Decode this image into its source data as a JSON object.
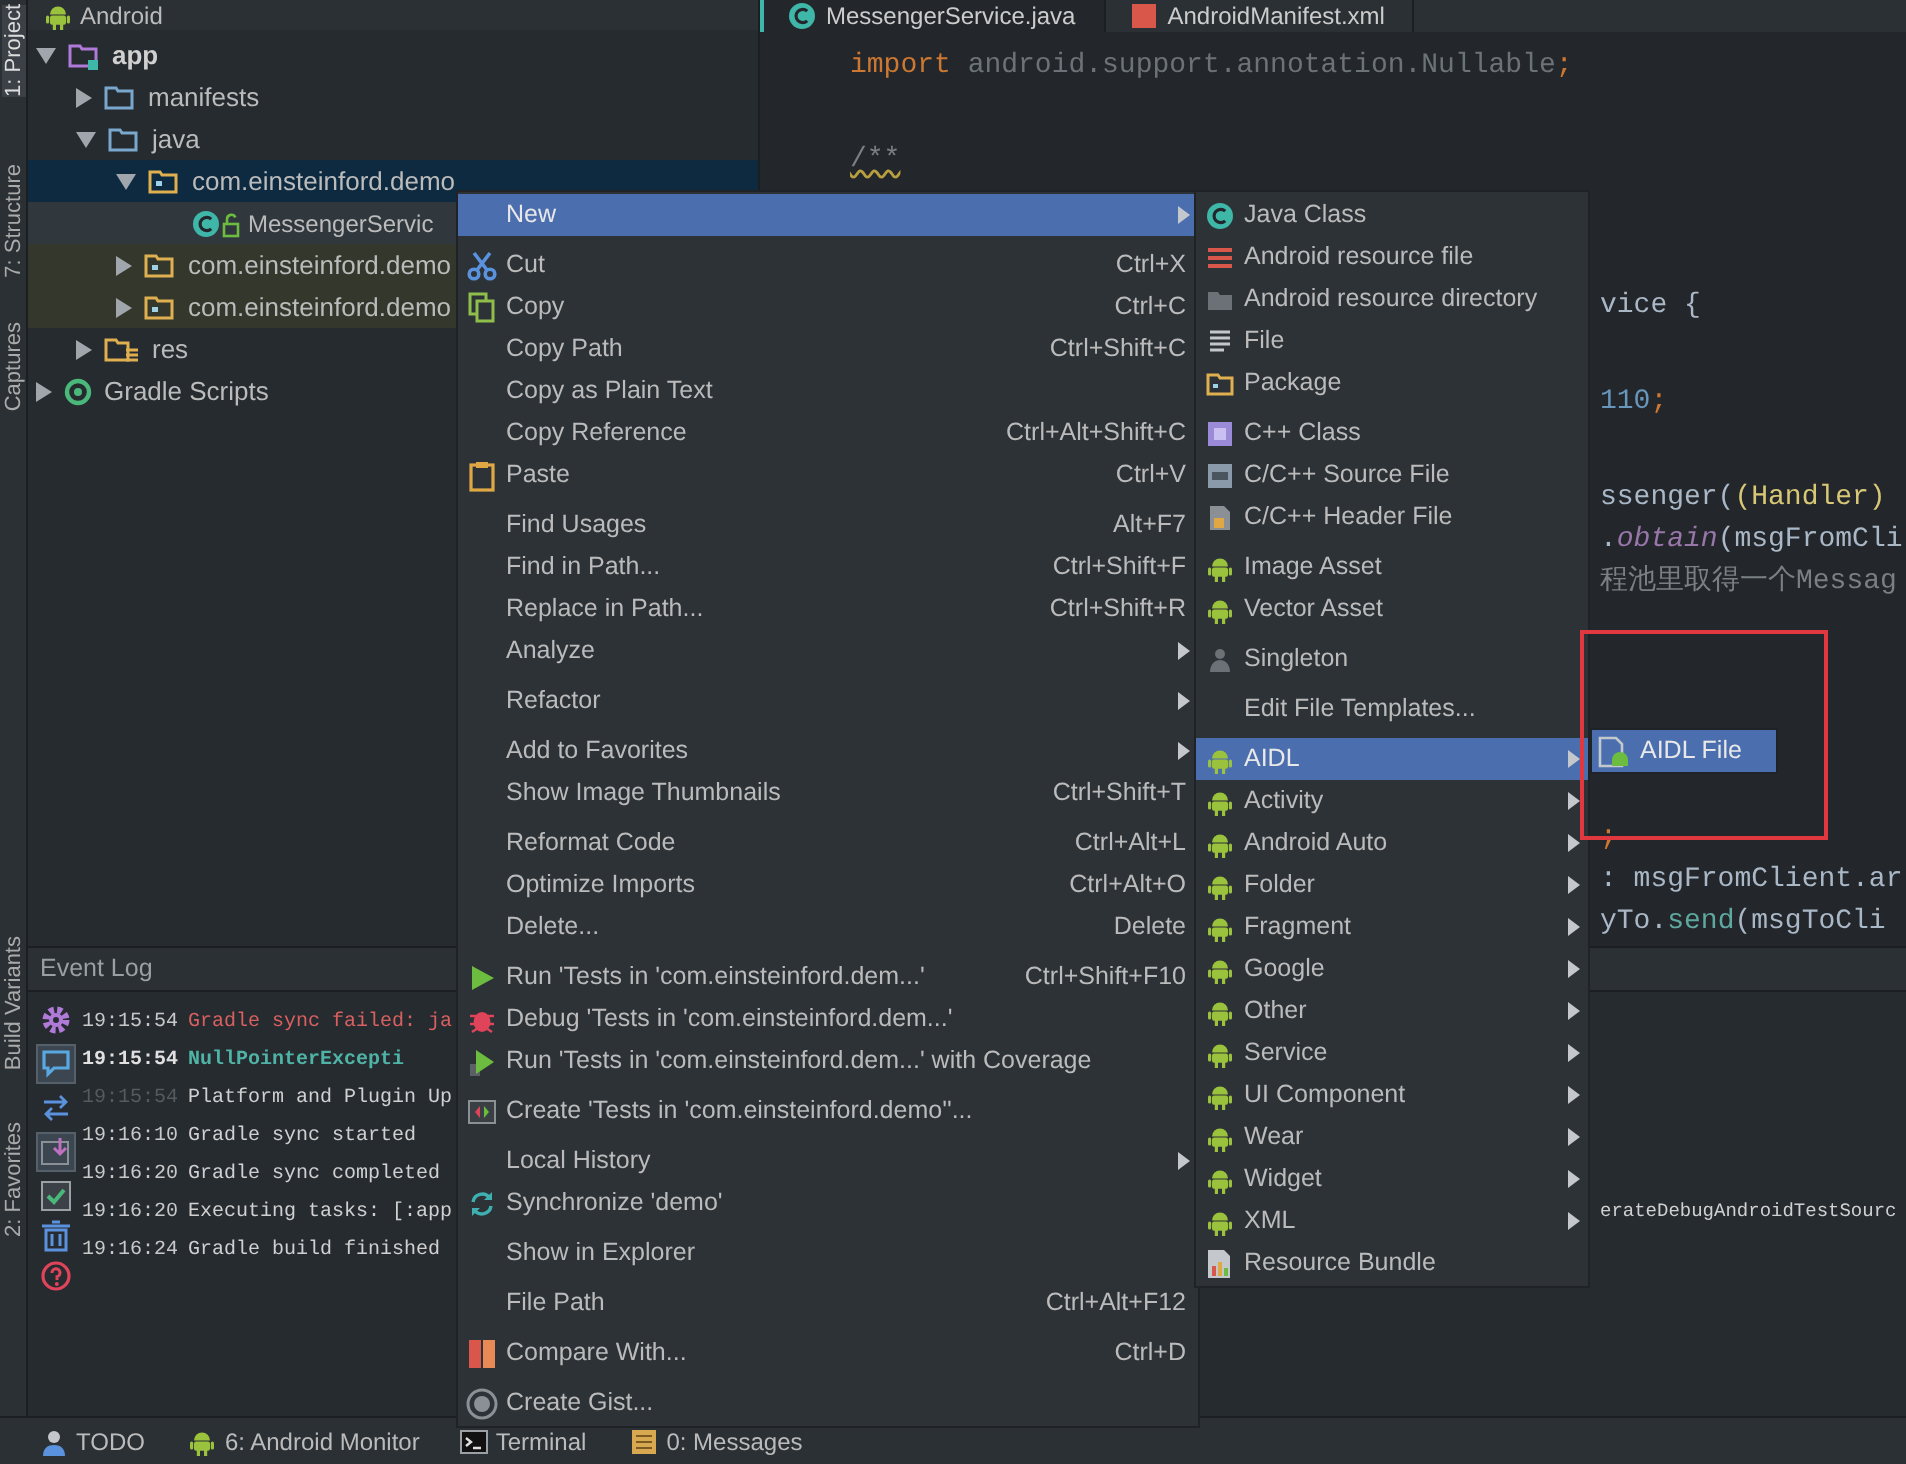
{
  "tool_strip": [
    {
      "label": "1: Project",
      "selected": true
    },
    {
      "label": "7: Structure",
      "selected": false
    },
    {
      "label": "Captures",
      "selected": false
    },
    {
      "label": "Build Variants",
      "selected": false
    },
    {
      "label": "2: Favorites",
      "selected": false
    }
  ],
  "project_panel": {
    "view": "Android",
    "tree": [
      {
        "label": "app",
        "kind": "module",
        "expanded": true,
        "selected": false,
        "children": [
          {
            "label": "manifests",
            "kind": "folder",
            "expanded": false,
            "selected": false
          },
          {
            "label": "java",
            "kind": "folder",
            "expanded": true,
            "selected": false,
            "children": [
              {
                "label": "com.einsteinford.demo",
                "kind": "package",
                "expanded": true,
                "selected": true,
                "children": [
                  {
                    "label": "MessengerServic",
                    "kind": "class",
                    "selected": false,
                    "color": "#30383d"
                  }
                ]
              },
              {
                "label": "com.einsteinford.demo",
                "kind": "package",
                "expanded": false,
                "selected": false,
                "color": "#33372c"
              },
              {
                "label": "com.einsteinford.demo",
                "kind": "package",
                "expanded": false,
                "selected": false,
                "color": "#33372c"
              }
            ]
          },
          {
            "label": "res",
            "kind": "res",
            "expanded": false,
            "selected": false
          }
        ]
      },
      {
        "label": "Gradle Scripts",
        "kind": "gradle",
        "expanded": false,
        "selected": false
      }
    ]
  },
  "editor": {
    "tabs": [
      {
        "label": "MessengerService.java",
        "kind": "class",
        "selected": true
      },
      {
        "label": "AndroidManifest.xml",
        "kind": "xml",
        "selected": false
      }
    ],
    "lines": [
      {
        "kind": "full",
        "segments": [
          {
            "text": "import",
            "kind": "keyword"
          },
          {
            "text": " android.support.annotation.Nullable",
            "kind": "unused"
          },
          {
            "text": ";",
            "kind": "keyword"
          }
        ]
      },
      {
        "kind": "doc",
        "segments": [
          {
            "text": "/**",
            "kind": "comment"
          }
        ]
      },
      {
        "kind": "fragment",
        "segments": [
          {
            "text": "vice {",
            "kind": "plain"
          }
        ]
      },
      {
        "kind": "fragment",
        "segments": [
          {
            "text": "110",
            "kind": "number"
          },
          {
            "text": ";",
            "kind": "keyword"
          }
        ]
      },
      {
        "kind": "fragment",
        "segments": [
          {
            "text": "ssenger(",
            "kind": "plain"
          },
          {
            "text": "(Handler)",
            "kind": "type"
          }
        ]
      },
      {
        "kind": "fragment",
        "segments": [
          {
            "text": ".",
            "kind": "plain"
          },
          {
            "text": "obtain",
            "kind": "static"
          },
          {
            "text": "(msgFromCli",
            "kind": "plain"
          }
        ]
      },
      {
        "kind": "fragment",
        "segments": [
          {
            "text": "程池里取得一个Messag",
            "kind": "comment"
          }
        ]
      },
      {
        "kind": "fragment",
        "segments": [
          {
            "text": ";",
            "kind": "keyword"
          }
        ]
      },
      {
        "kind": "fragment",
        "segments": [
          {
            "text": ": msgFromClient.ar",
            "kind": "plain"
          }
        ]
      },
      {
        "kind": "fragment",
        "segments": [
          {
            "text": "yTo.",
            "kind": "plain"
          },
          {
            "text": "send",
            "kind": "method"
          },
          {
            "text": "(msgToCli",
            "kind": "plain"
          }
        ]
      }
    ]
  },
  "event_log": {
    "title": "Event Log",
    "entries": [
      {
        "time": "19:15:54",
        "message": "Gradle sync failed: ja",
        "kind": "error"
      },
      {
        "time": "19:15:54",
        "message": "NullPointerExcepti",
        "kind": "bold"
      },
      {
        "time": "19:15:54",
        "message": "Platform and Plugin Up",
        "kind": "read"
      },
      {
        "time": "19:16:10",
        "message": "Gradle sync started",
        "kind": "normal"
      },
      {
        "time": "19:16:20",
        "message": "Gradle sync completed",
        "kind": "normal"
      },
      {
        "time": "19:16:20",
        "message": "Executing tasks: [:app",
        "kind": "normal",
        "tail": "erateDebugAndroidTestSourc"
      },
      {
        "time": "19:16:24",
        "message": "Gradle build finished",
        "kind": "normal"
      }
    ]
  },
  "context_menu": {
    "groups": [
      [
        {
          "label": "New",
          "submenu": true,
          "selected": true
        }
      ],
      [
        {
          "label": "Cut",
          "shortcut": "Ctrl+X",
          "kind": "scissors",
          "selected": false
        },
        {
          "label": "Copy",
          "shortcut": "Ctrl+C",
          "kind": "copy",
          "selected": false
        },
        {
          "label": "Copy Path",
          "shortcut": "Ctrl+Shift+C",
          "selected": false
        },
        {
          "label": "Copy as Plain Text",
          "selected": false
        },
        {
          "label": "Copy Reference",
          "shortcut": "Ctrl+Alt+Shift+C",
          "selected": false
        },
        {
          "label": "Paste",
          "shortcut": "Ctrl+V",
          "kind": "paste",
          "selected": false
        }
      ],
      [
        {
          "label": "Find Usages",
          "shortcut": "Alt+F7",
          "selected": false
        },
        {
          "label": "Find in Path...",
          "shortcut": "Ctrl+Shift+F",
          "selected": false
        },
        {
          "label": "Replace in Path...",
          "shortcut": "Ctrl+Shift+R",
          "selected": false
        },
        {
          "label": "Analyze",
          "submenu": true,
          "selected": false
        }
      ],
      [
        {
          "label": "Refactor",
          "submenu": true,
          "selected": false
        }
      ],
      [
        {
          "label": "Add to Favorites",
          "submenu": true,
          "selected": false
        },
        {
          "label": "Show Image Thumbnails",
          "shortcut": "Ctrl+Shift+T",
          "selected": false
        }
      ],
      [
        {
          "label": "Reformat Code",
          "shortcut": "Ctrl+Alt+L",
          "selected": false
        },
        {
          "label": "Optimize Imports",
          "shortcut": "Ctrl+Alt+O",
          "selected": false
        },
        {
          "label": "Delete...",
          "shortcut": "Delete",
          "selected": false
        }
      ],
      [
        {
          "label": "Run 'Tests in 'com.einsteinford.dem...'",
          "shortcut": "Ctrl+Shift+F10",
          "kind": "run",
          "selected": false
        },
        {
          "label": "Debug 'Tests in 'com.einsteinford.dem...'",
          "kind": "debug",
          "selected": false
        },
        {
          "label": "Run 'Tests in 'com.einsteinford.dem...' with Coverage",
          "kind": "coverage",
          "selected": false
        }
      ],
      [
        {
          "label": "Create 'Tests in 'com.einsteinford.demo''...",
          "kind": "tests",
          "selected": false
        }
      ],
      [
        {
          "label": "Local History",
          "submenu": true,
          "selected": false
        },
        {
          "label": "Synchronize 'demo'",
          "kind": "sync",
          "selected": false
        }
      ],
      [
        {
          "label": "Show in Explorer",
          "selected": false
        }
      ],
      [
        {
          "label": "File Path",
          "shortcut": "Ctrl+Alt+F12",
          "selected": false
        }
      ],
      [
        {
          "label": "Compare With...",
          "shortcut": "Ctrl+D",
          "kind": "compare",
          "selected": false
        }
      ],
      [
        {
          "label": "Create Gist...",
          "kind": "gist",
          "selected": false
        }
      ]
    ]
  },
  "new_submenu": {
    "groups": [
      [
        {
          "label": "Java Class",
          "kind": "class",
          "selected": false
        },
        {
          "label": "Android resource file",
          "kind": "resfile",
          "selected": false
        },
        {
          "label": "Android resource directory",
          "kind": "resdir",
          "selected": false
        },
        {
          "label": "File",
          "kind": "file",
          "selected": false
        },
        {
          "label": "Package",
          "kind": "package",
          "selected": false
        }
      ],
      [
        {
          "label": "C++ Class",
          "kind": "cppclass",
          "selected": false
        },
        {
          "label": "C/C++ Source File",
          "kind": "cppsource",
          "selected": false
        },
        {
          "label": "C/C++ Header File",
          "kind": "cppheader",
          "selected": false
        }
      ],
      [
        {
          "label": "Image Asset",
          "kind": "android",
          "selected": false
        },
        {
          "label": "Vector Asset",
          "kind": "android",
          "selected": false
        }
      ],
      [
        {
          "label": "Singleton",
          "kind": "singleton",
          "selected": false
        }
      ],
      [
        {
          "label": "Edit File Templates...",
          "selected": false
        }
      ],
      [
        {
          "label": "AIDL",
          "kind": "android",
          "submenu": true,
          "selected": true
        },
        {
          "label": "Activity",
          "kind": "android",
          "submenu": true,
          "selected": false
        },
        {
          "label": "Android Auto",
          "kind": "android",
          "submenu": true,
          "selected": false
        },
        {
          "label": "Folder",
          "kind": "android",
          "submenu": true,
          "selected": false
        },
        {
          "label": "Fragment",
          "kind": "android",
          "submenu": true,
          "selected": false
        },
        {
          "label": "Google",
          "kind": "android",
          "submenu": true,
          "selected": false
        },
        {
          "label": "Other",
          "kind": "android",
          "submenu": true,
          "selected": false
        },
        {
          "label": "Service",
          "kind": "android",
          "submenu": true,
          "selected": false
        },
        {
          "label": "UI Component",
          "kind": "android",
          "submenu": true,
          "selected": false
        },
        {
          "label": "Wear",
          "kind": "android",
          "submenu": true,
          "selected": false
        },
        {
          "label": "Widget",
          "kind": "android",
          "submenu": true,
          "selected": false
        },
        {
          "label": "XML",
          "kind": "android",
          "submenu": true,
          "selected": false
        },
        {
          "label": "Resource Bundle",
          "kind": "bundle",
          "selected": false
        }
      ]
    ]
  },
  "aidl_submenu": {
    "items": [
      {
        "label": "AIDL File",
        "kind": "aidlfile",
        "selected": true
      }
    ]
  },
  "bottom_bar": [
    {
      "label": "TODO",
      "kind": "todo"
    },
    {
      "label": "6: Android Monitor",
      "kind": "android"
    },
    {
      "label": "Terminal",
      "kind": "terminal"
    },
    {
      "label": "0: Messages",
      "kind": "messages"
    }
  ]
}
